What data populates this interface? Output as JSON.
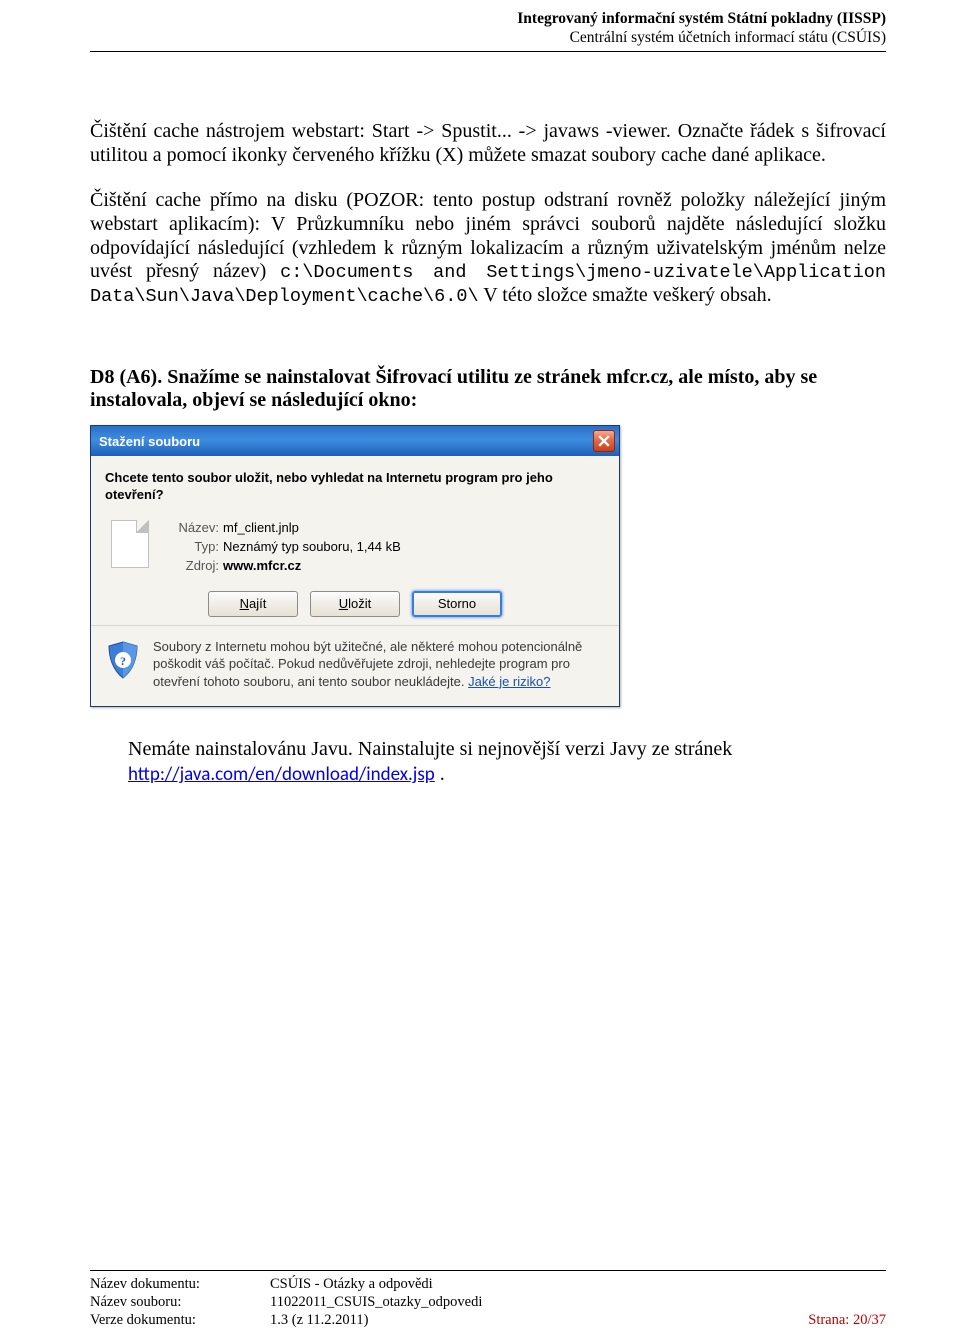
{
  "header": {
    "line1": "Integrovaný informační systém Státní pokladny (IISSP)",
    "line2": "Centrální systém účetních informací státu (CSÚIS)"
  },
  "body": {
    "para1_a": "Čištění cache nástrojem webstart: Start -> Spustit... -> javaws -viewer. Označte řádek s šifrovací utilitou a pomocí ikonky červeného křížku (X) můžete smazat soubory cache dané aplikace.",
    "para2_a": "Čištění cache přímo na disku (POZOR: tento postup odstraní rovněž položky náležející jiným webstart aplikacím): V Průzkumníku nebo jiném správci souborů najděte následující složku odpovídající následující (vzhledem k různým lokalizacím a různým uživatelským jménům nelze uvést přesný název) ",
    "para2_mono": "c:\\Documents and Settings\\jmeno-uzivatele\\Application Data\\Sun\\Java\\Deployment\\cache\\6.0\\",
    "para2_b": " V této složce smažte veškerý obsah.",
    "heading": "D8 (A6). Snažíme se nainstalovat Šifrovací utilitu ze stránek mfcr.cz, ale místo, aby se instalovala, objeví se následující okno:"
  },
  "dialog": {
    "title": "Stažení souboru",
    "prompt": "Chcete tento soubor uložit, nebo vyhledat na Internetu program pro jeho otevření?",
    "labels": {
      "name": "Název:",
      "type": "Typ:",
      "source": "Zdroj:"
    },
    "values": {
      "name": "mf_client.jnlp",
      "type": "Neznámý typ souboru, 1,44 kB",
      "source": "www.mfcr.cz"
    },
    "buttons": {
      "find_pre": "",
      "find_ul": "N",
      "find_post": "ajít",
      "save_pre": "",
      "save_ul": "U",
      "save_post": "ložit",
      "cancel": "Storno"
    },
    "info": "Soubory z Internetu mohou být užitečné, ale některé mohou potencionálně poškodit váš počítač. Pokud nedůvěřujete zdroji, nehledejte program pro otevření tohoto souboru, ani tento soubor neukládejte. ",
    "risk": "Jaké je riziko?"
  },
  "answer": {
    "text_a": "Nemáte nainstalovánu Javu. Nainstalujte si nejnovější verzi Javy ze stránek ",
    "link": "http://java.com/en/download/index.jsp",
    "text_b": " ."
  },
  "footer": {
    "r1l": "Název dokumentu:",
    "r1v": "CSÚIS - Otázky a odpovědi",
    "r2l": "Název souboru:",
    "r2v": "11022011_CSUIS_otazky_odpovedi",
    "r3l": "Verze dokumentu:",
    "r3v": "1.3 (z 11.2.2011)",
    "page": "Strana: 20/37"
  }
}
